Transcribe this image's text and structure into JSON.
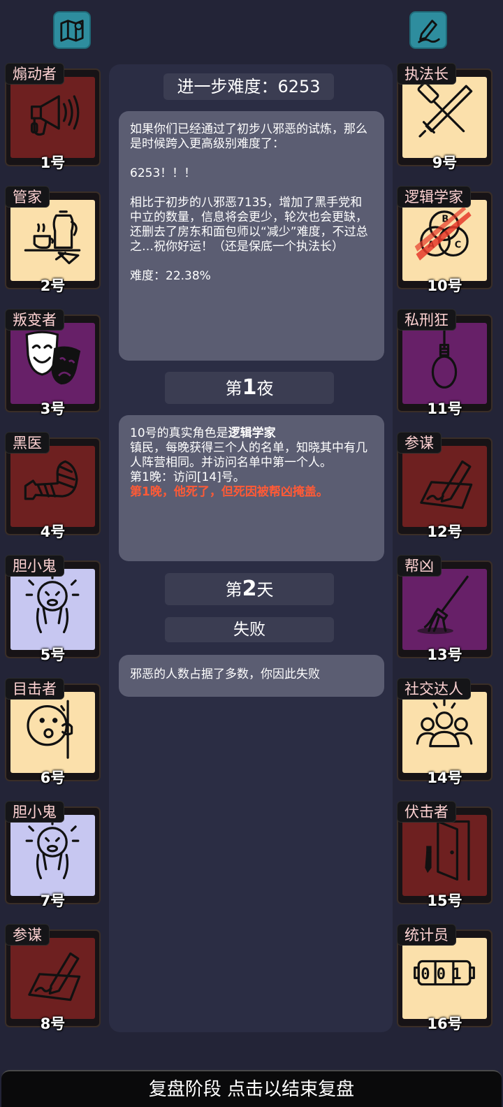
{
  "header": {
    "difficulty_label": "进一步难度：6253"
  },
  "intro": {
    "lines": [
      "如果你们已经通过了初步八邪恶的试炼，那么是时候跨入更高级别难度了：",
      "6253！！！",
      "相比于初步的八邪恶7135，增加了黑手党和中立的数量，信息将会更少，轮次也会更缺，还删去了房东和面包师以“减少”难度，不过总之…祝你好运！（还是保底一个执法长）",
      "难度：22.38%"
    ]
  },
  "night1": {
    "prefix": "第",
    "num": "1",
    "suffix": "夜"
  },
  "night1_log": {
    "line1_plain": "10号的真实角色是",
    "line1_bold": "逻辑学家",
    "line2": "镇民，每晚获得三个人的名单，知晓其中有几人阵营相同。并访问名单中第一个人。",
    "line3": "第1晚：访问[14]号。",
    "line4_alert": "第1晚，他死了，但死因被帮凶掩盖。"
  },
  "day2": {
    "prefix": "第",
    "num": "2",
    "suffix": "天"
  },
  "result": {
    "label": "失败",
    "message": "邪恶的人数占据了多数，你因此失败"
  },
  "bottom_bar": {
    "label": "复盘阶段 点击以结束复盘"
  },
  "colors": {
    "red": "#6e2020",
    "cream": "#fbe0ab",
    "purple": "#672068",
    "lavender": "#c7c7f1",
    "alert": "#ff5a36",
    "teal": "#2e8d9e"
  },
  "players_left": [
    {
      "role": "煽动者",
      "num": "1号",
      "color": "red",
      "icon": "megaphone-icon"
    },
    {
      "role": "管家",
      "num": "2号",
      "color": "cream",
      "icon": "butler-tray-icon"
    },
    {
      "role": "叛变者",
      "num": "3号",
      "color": "purple",
      "icon": "theater-masks-icon"
    },
    {
      "role": "黑医",
      "num": "4号",
      "color": "red",
      "icon": "bandaged-arm-icon"
    },
    {
      "role": "胆小鬼",
      "num": "5号",
      "color": "lav",
      "icon": "scared-face-icon"
    },
    {
      "role": "目击者",
      "num": "6号",
      "color": "cream",
      "icon": "peeking-face-icon"
    },
    {
      "role": "胆小鬼",
      "num": "7号",
      "color": "lav",
      "icon": "scared-face-icon"
    },
    {
      "role": "参谋",
      "num": "8号",
      "color": "red",
      "icon": "pen-writing-icon"
    }
  ],
  "players_right": [
    {
      "role": "执法长",
      "num": "9号",
      "color": "cream",
      "icon": "hammer-sword-icon"
    },
    {
      "role": "逻辑学家",
      "num": "10号",
      "color": "cream",
      "icon": "venn-diagram-icon"
    },
    {
      "role": "私刑狂",
      "num": "11号",
      "color": "purple",
      "icon": "noose-icon"
    },
    {
      "role": "参谋",
      "num": "12号",
      "color": "red",
      "icon": "pen-writing-icon"
    },
    {
      "role": "帮凶",
      "num": "13号",
      "color": "purple",
      "icon": "mop-icon"
    },
    {
      "role": "社交达人",
      "num": "14号",
      "color": "cream",
      "icon": "group-people-icon"
    },
    {
      "role": "伏击者",
      "num": "15号",
      "color": "red",
      "icon": "door-knife-icon"
    },
    {
      "role": "统计员",
      "num": "16号",
      "color": "cream",
      "icon": "counter-icon"
    }
  ],
  "counter_value": "001",
  "venn_letters": [
    "B",
    "A",
    "C"
  ]
}
